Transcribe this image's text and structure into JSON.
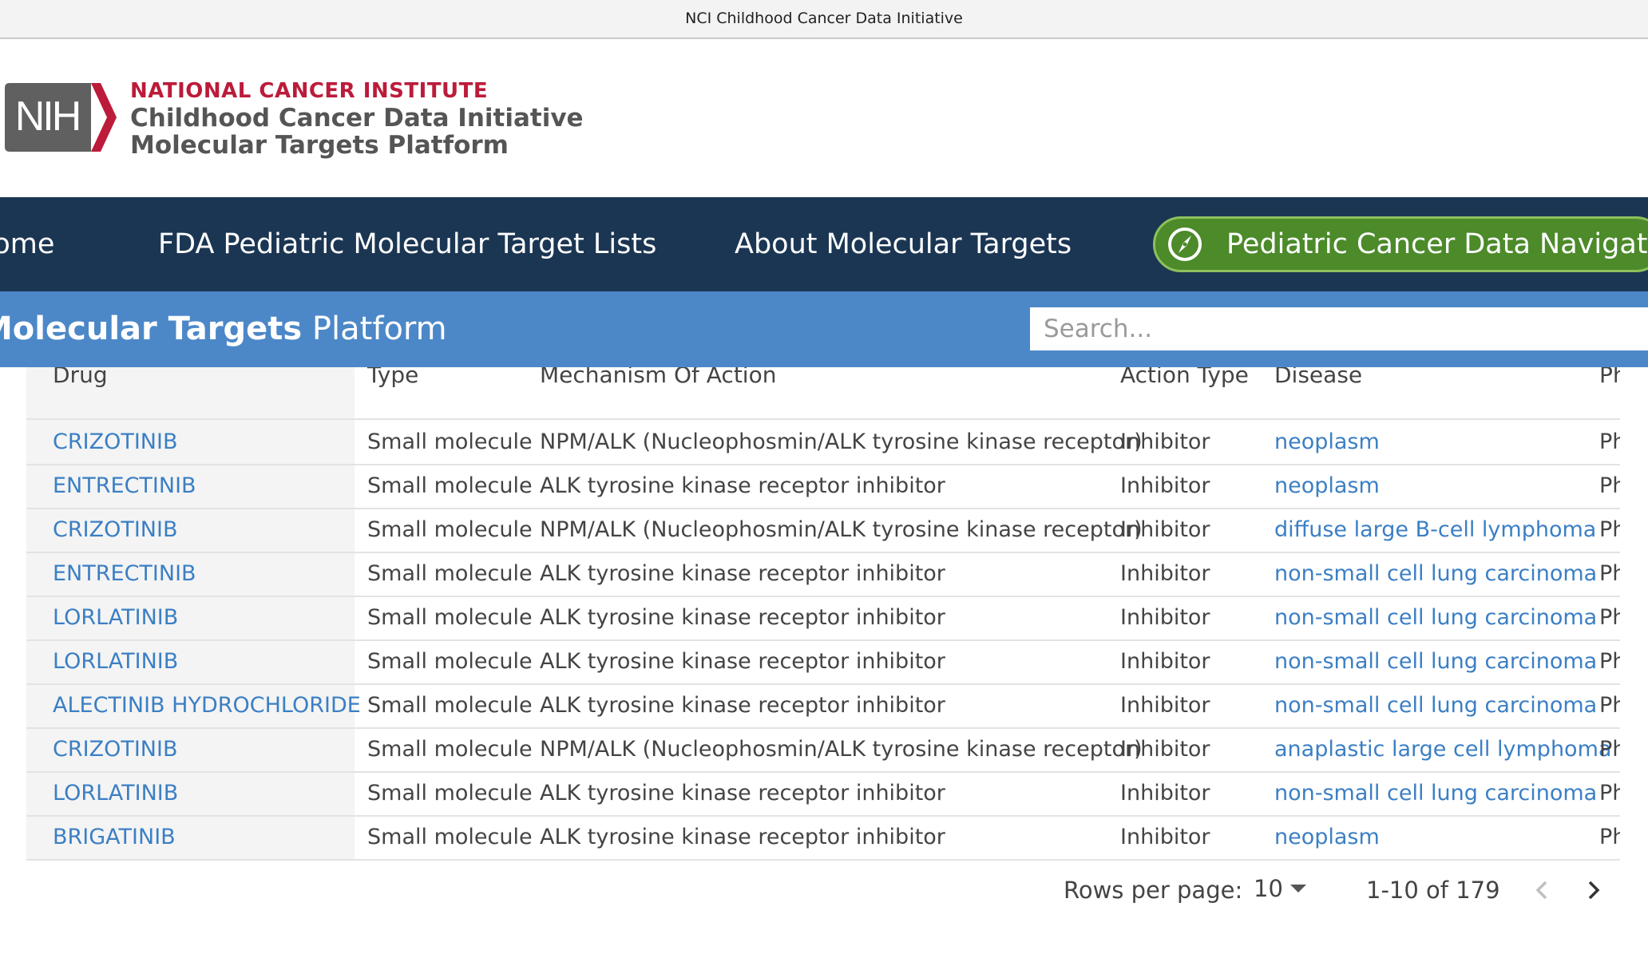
{
  "window": {
    "title": "NCI Childhood Cancer Data Initiative"
  },
  "header": {
    "logo_text": "NIH",
    "brand_line1": "NATIONAL CANCER INSTITUTE",
    "brand_line2": "Childhood Cancer Data Initiative",
    "brand_line3": "Molecular Targets Platform"
  },
  "nav": {
    "items": [
      {
        "label": "Home"
      },
      {
        "label": "FDA Pediatric Molecular Target Lists"
      },
      {
        "label": "About Molecular Targets"
      }
    ],
    "cta_label": "Pediatric Cancer Data Navigation",
    "cta_color": "#4c8a2a",
    "bg_color": "#1b3653"
  },
  "subbar": {
    "title_strong": "Molecular Targets",
    "title_light": " Platform",
    "search_placeholder": "Search...",
    "bg_color": "#4c88c8"
  },
  "table": {
    "columns": [
      "Drug",
      "Type",
      "Mechanism Of Action",
      "Action Type",
      "Disease",
      "Phase"
    ],
    "rows": [
      {
        "drug": "CRIZOTINIB",
        "type": "Small molecule",
        "moa": "NPM/ALK (Nucleophosmin/ALK tyrosine kinase receptor)",
        "action": "Inhibitor",
        "disease": "neoplasm",
        "phase": "Phase"
      },
      {
        "drug": "ENTRECTINIB",
        "type": "Small molecule",
        "moa": "ALK tyrosine kinase receptor inhibitor",
        "action": "Inhibitor",
        "disease": "neoplasm",
        "phase": "Phase"
      },
      {
        "drug": "CRIZOTINIB",
        "type": "Small molecule",
        "moa": "NPM/ALK (Nucleophosmin/ALK tyrosine kinase receptor)",
        "action": "Inhibitor",
        "disease": "diffuse large B-cell lymphoma",
        "phase": "Phase"
      },
      {
        "drug": "ENTRECTINIB",
        "type": "Small molecule",
        "moa": "ALK tyrosine kinase receptor inhibitor",
        "action": "Inhibitor",
        "disease": "non-small cell lung carcinoma",
        "phase": "Phase"
      },
      {
        "drug": "LORLATINIB",
        "type": "Small molecule",
        "moa": "ALK tyrosine kinase receptor inhibitor",
        "action": "Inhibitor",
        "disease": "non-small cell lung carcinoma",
        "phase": "Phase"
      },
      {
        "drug": "LORLATINIB",
        "type": "Small molecule",
        "moa": "ALK tyrosine kinase receptor inhibitor",
        "action": "Inhibitor",
        "disease": "non-small cell lung carcinoma",
        "phase": "Phase"
      },
      {
        "drug": "ALECTINIB HYDROCHLORIDE",
        "type": "Small molecule",
        "moa": "ALK tyrosine kinase receptor inhibitor",
        "action": "Inhibitor",
        "disease": "non-small cell lung carcinoma",
        "phase": "Phase"
      },
      {
        "drug": "CRIZOTINIB",
        "type": "Small molecule",
        "moa": "NPM/ALK (Nucleophosmin/ALK tyrosine kinase receptor)",
        "action": "Inhibitor",
        "disease": "anaplastic large cell lymphoma",
        "phase": "Phase"
      },
      {
        "drug": "LORLATINIB",
        "type": "Small molecule",
        "moa": "ALK tyrosine kinase receptor inhibitor",
        "action": "Inhibitor",
        "disease": "non-small cell lung carcinoma",
        "phase": "Phase"
      },
      {
        "drug": "BRIGATINIB",
        "type": "Small molecule",
        "moa": "ALK tyrosine kinase receptor inhibitor",
        "action": "Inhibitor",
        "disease": "neoplasm",
        "phase": "Phase"
      }
    ]
  },
  "pagination": {
    "rows_per_page_label": "Rows per page:",
    "rows_per_page_value": "10",
    "range": "1-10 of 179"
  },
  "colors": {
    "link": "#3b7fc4",
    "brand_red": "#bc1b3a"
  }
}
